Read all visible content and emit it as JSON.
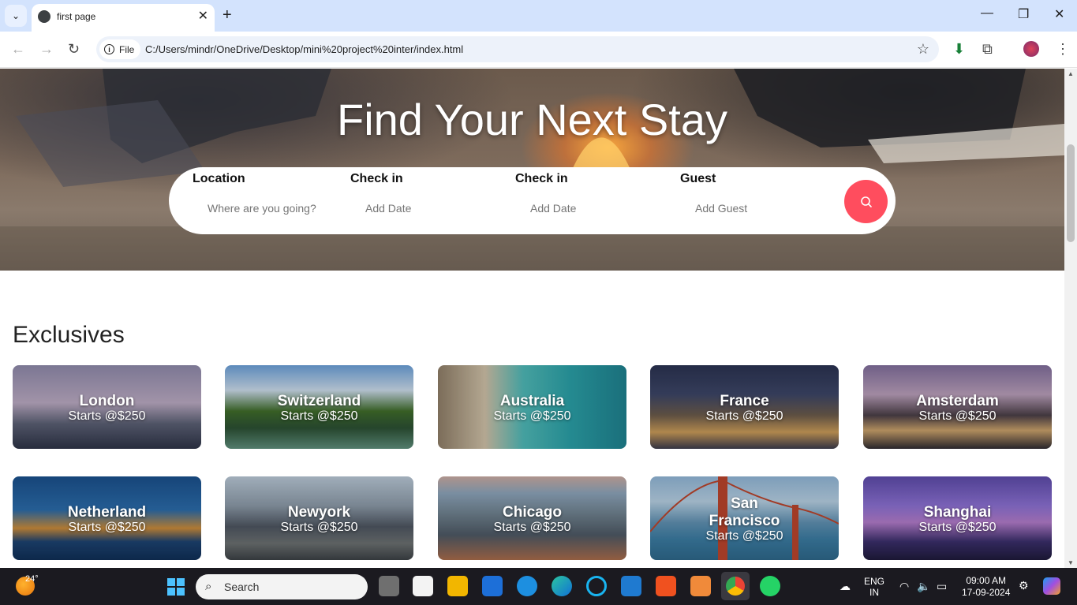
{
  "browser": {
    "tab_title": "first page",
    "file_chip": "File",
    "url": "C:/Users/mindr/OneDrive/Desktop/mini%20project%20inter/index.html"
  },
  "hero": {
    "title": "Find Your Next Stay",
    "fields": [
      {
        "label": "Location",
        "placeholder": "Where are you going?"
      },
      {
        "label": "Check in",
        "placeholder": "Add Date"
      },
      {
        "label": "Check in",
        "placeholder": "Add Date"
      },
      {
        "label": "Guest",
        "placeholder": "Add Guest"
      }
    ],
    "search_icon": "search-icon",
    "accent": "#ff4d5e"
  },
  "exclusives": {
    "title": "Exclusives",
    "cards": [
      {
        "name": "London",
        "price": "Starts @$250"
      },
      {
        "name": "Switzerland",
        "price": "Starts @$250"
      },
      {
        "name": "Australia",
        "price": "Starts @$250"
      },
      {
        "name": "France",
        "price": "Starts @$250"
      },
      {
        "name": "Amsterdam",
        "price": "Starts @$250"
      },
      {
        "name": "Netherland",
        "price": "Starts @$250"
      },
      {
        "name": "Newyork",
        "price": "Starts @$250"
      },
      {
        "name": "Chicago",
        "price": "Starts @$250"
      },
      {
        "name": "San Francisco",
        "price": "Starts @$250"
      },
      {
        "name": "Shanghai",
        "price": "Starts @$250"
      }
    ]
  },
  "taskbar": {
    "temperature": "24°",
    "search_label": "Search",
    "lang_top": "ENG",
    "lang_bottom": "IN",
    "time": "09:00 AM",
    "date": "17-09-2024"
  }
}
